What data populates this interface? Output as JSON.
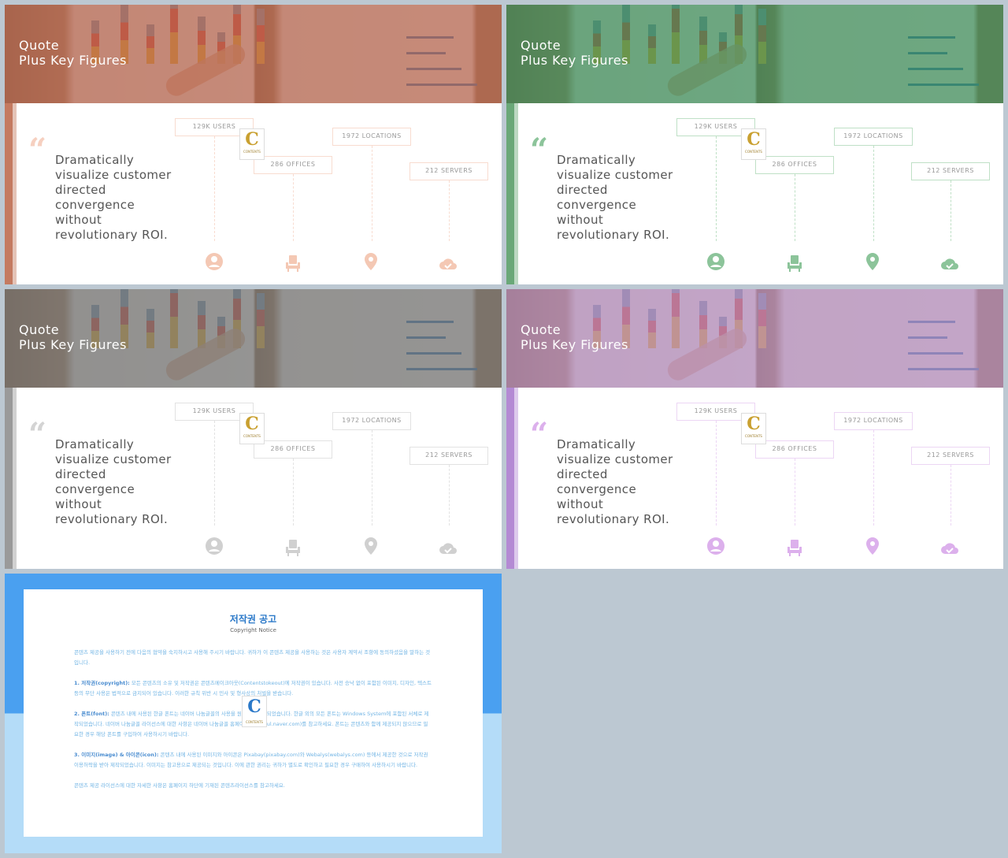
{
  "slides": [
    {
      "theme": "orange",
      "accent": "#c47a60",
      "overlay": "#b4624c",
      "icon": "#f4c8b4",
      "quote": "#f6d0c0",
      "box_border": "#f8dcd0"
    },
    {
      "theme": "green",
      "accent": "#6aa878",
      "overlay": "#3a8a58",
      "icon": "#8cc49a",
      "quote": "#8cc49a",
      "box_border": "#bfe0c6"
    },
    {
      "theme": "gray",
      "accent": "#9a9a9a",
      "overlay": "#707070",
      "icon": "#d0d0d0",
      "quote": "#d4d4d4",
      "box_border": "#e2e2e2"
    },
    {
      "theme": "purple",
      "accent": "#b48ad4",
      "overlay": "#b088b8",
      "icon": "#dcb0ec",
      "quote": "#dcb0ec",
      "box_border": "#ecd6f4"
    }
  ],
  "content": {
    "title_line1": "Quote",
    "title_line2": "Plus Key Figures",
    "quote_text": "Dramatically visualize customer directed convergence without revolutionary ROI.",
    "figures": [
      "129K USERS",
      "286 OFFICES",
      "1972 LOCATIONS",
      "212 SERVERS"
    ],
    "icons": [
      "user-icon",
      "chair-icon",
      "location-pin-icon",
      "cloud-check-icon"
    ],
    "logo_letter": "C",
    "logo_text": "CONTENTS"
  },
  "copyright": {
    "title": "저작권 공고",
    "subtitle": "Copyright Notice",
    "intro": "콘텐츠 제공을 사용하기 전에 다음의 협약을 숙지하시고 사용해 주시기 바랍니다. 귀하가 이 콘텐츠 제공을 사용하는 것은 사용자 계약서 조항에 동의하셨음을 말하는 것입니다.",
    "items": [
      {
        "head": "1. 저작권(copyright):",
        "body": "모든 콘텐츠의 소유 및 저작권은 콘텐츠메이크아웃(Contentstokeout)에 저작권이 있습니다. 사전 승낙 없이 포함된 이미지, 디자인, 텍스트 등의 무단 사용은 법적으로 금지되어 있습니다. 이러한 규칙 위반 시 민사 및 형사상의 처벌을 받습니다."
      },
      {
        "head": "2. 폰트(font):",
        "body": "콘텐츠 내에 사용된 한글 폰트는 네이버 나눔글꼴의 사용을 원칙으로 제작되었습니다. 한글 외의 모든 폰트는 Windows System에 포함된 서체로 제작되었습니다. 네이버 나눔글꼴 라이선스에 대한 사항은 네이버 나눔글꼴 홈페이지(hangeul.naver.com)를 참고하세요. 폰트는 콘텐츠와 함께 제공되지 않으므로 필요한 경우 해당 폰트를 구입하여 사용하시기 바랍니다."
      },
      {
        "head": "3. 이미지(image) & 아이콘(icon):",
        "body": "콘텐츠 내에 사용된 이미지와 아이콘은 Pixabay(pixabay.com)와 Webalys(webalys.com) 등에서 제공한 것으로 저작권 이용허락을 받아 제작되었습니다. 이미지는 참고용으로 제공되는 것입니다. 이에 관한 권리는 귀하가 별도로 확인하고 필요한 경우 구매하여 사용하시기 바랍니다."
      }
    ],
    "footer": "콘텐츠 제공 라이선스에 대한 자세한 사항은 홈페이지 하단에 기재된 콘텐츠라이선스를 참고하세요."
  }
}
